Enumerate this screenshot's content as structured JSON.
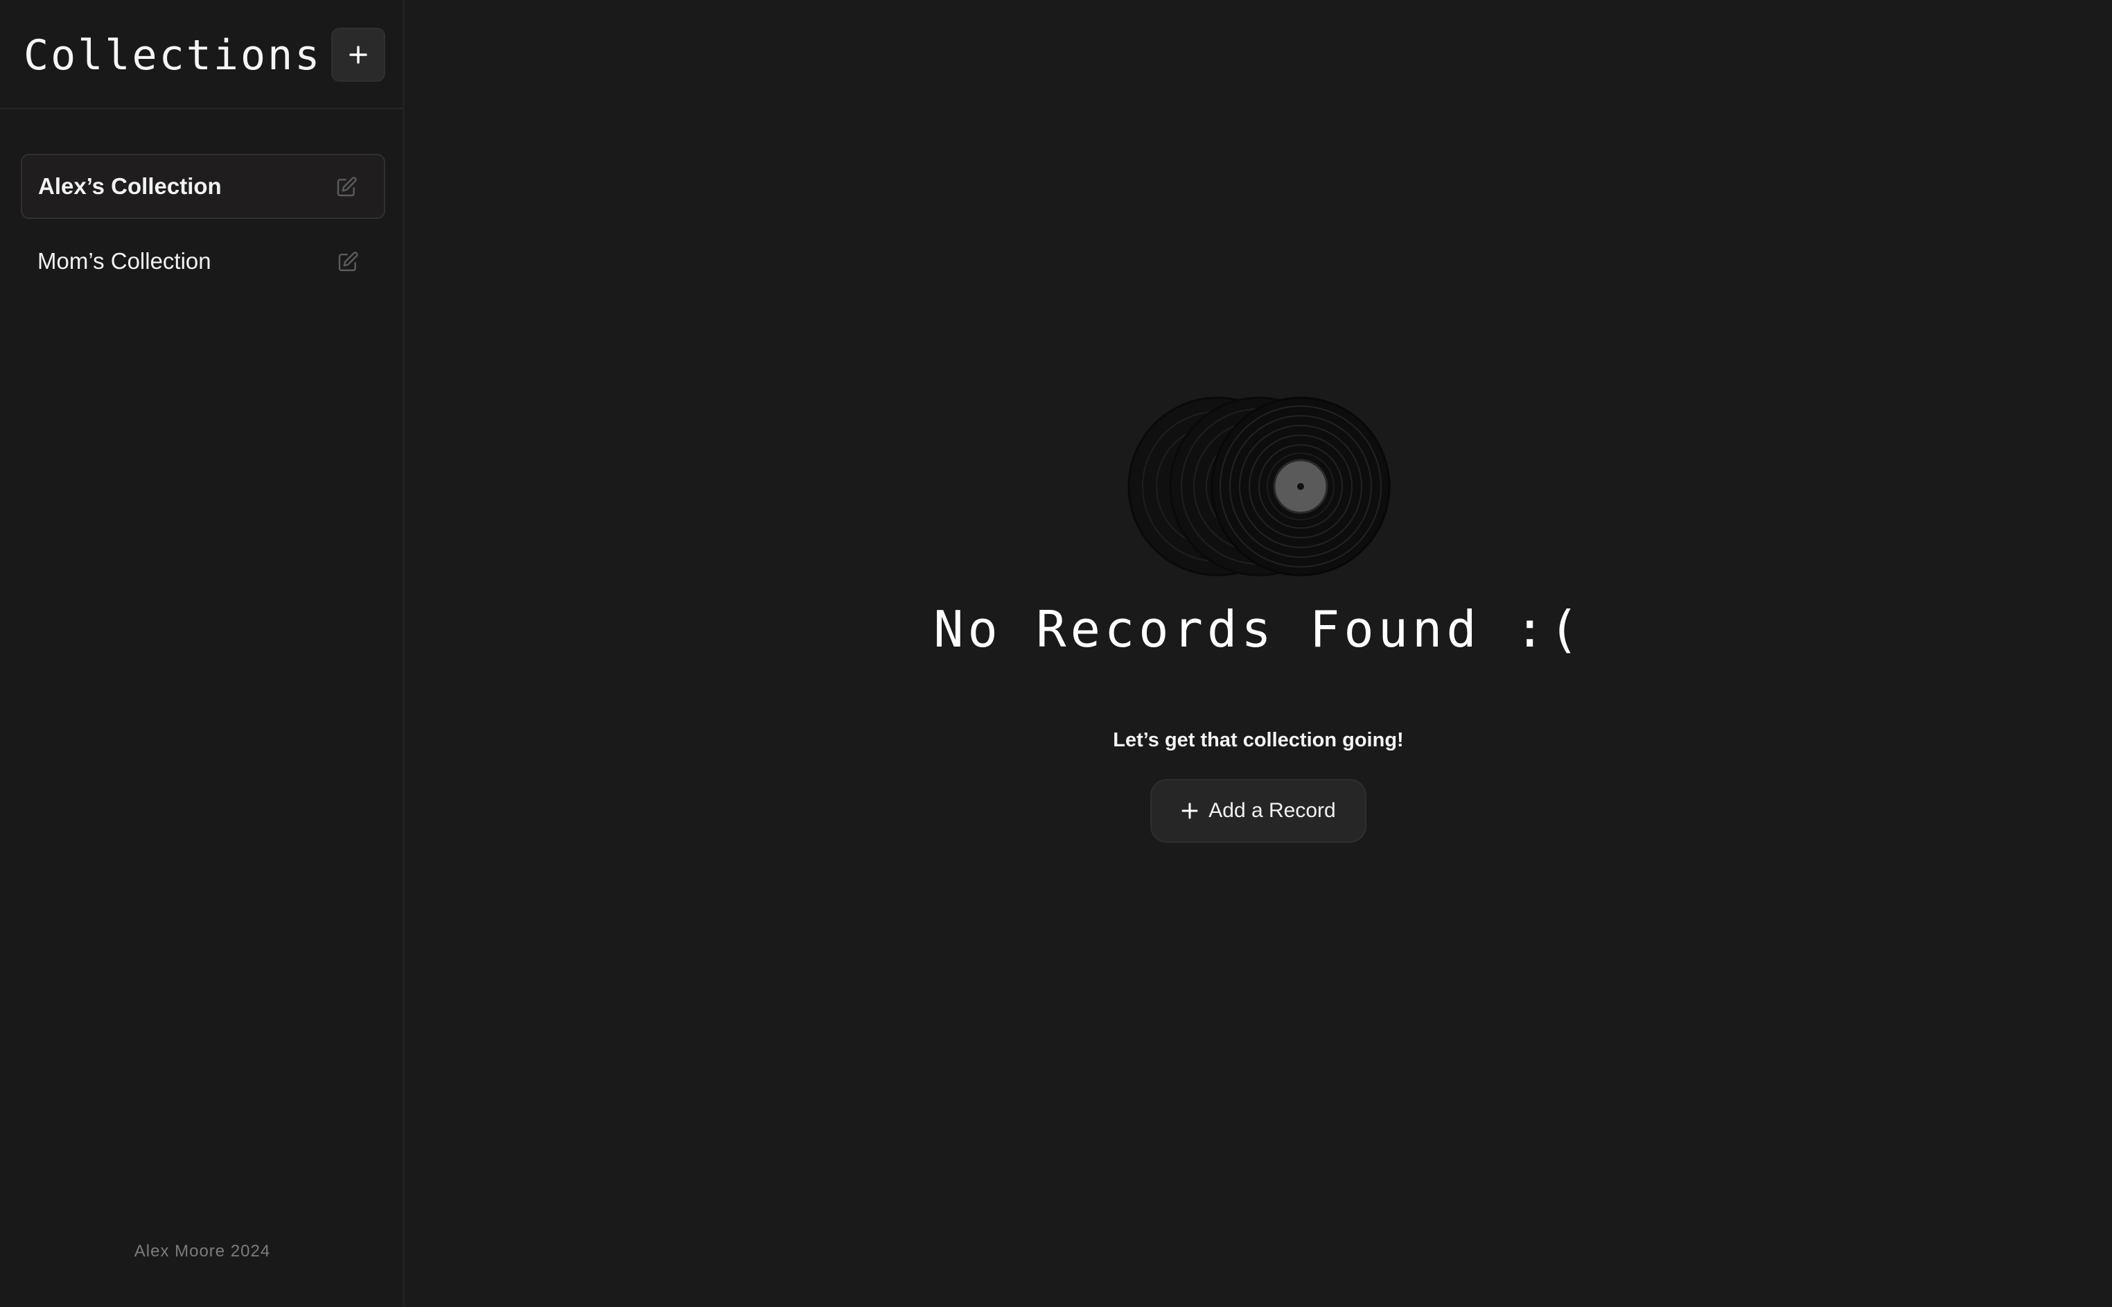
{
  "sidebar": {
    "title": "Collections",
    "add_button_icon": "plus-icon",
    "items": [
      {
        "label": "Alex’s Collection",
        "active": true,
        "icon": "edit-icon"
      },
      {
        "label": "Mom’s Collection",
        "active": false,
        "icon": "edit-icon"
      }
    ],
    "footer": "Alex Moore 2024"
  },
  "main": {
    "empty_icon": "vinyl-records-icon",
    "title": "No Records Found :(",
    "subtitle": "Let’s get that collection going!",
    "add_button": {
      "icon": "plus-icon",
      "label": "Add a Record"
    }
  },
  "colors": {
    "background": "#1a1a1a",
    "sidebar": "#191919",
    "button": "#262626",
    "text": "#ffffff",
    "muted_text": "#7c7c7c"
  }
}
